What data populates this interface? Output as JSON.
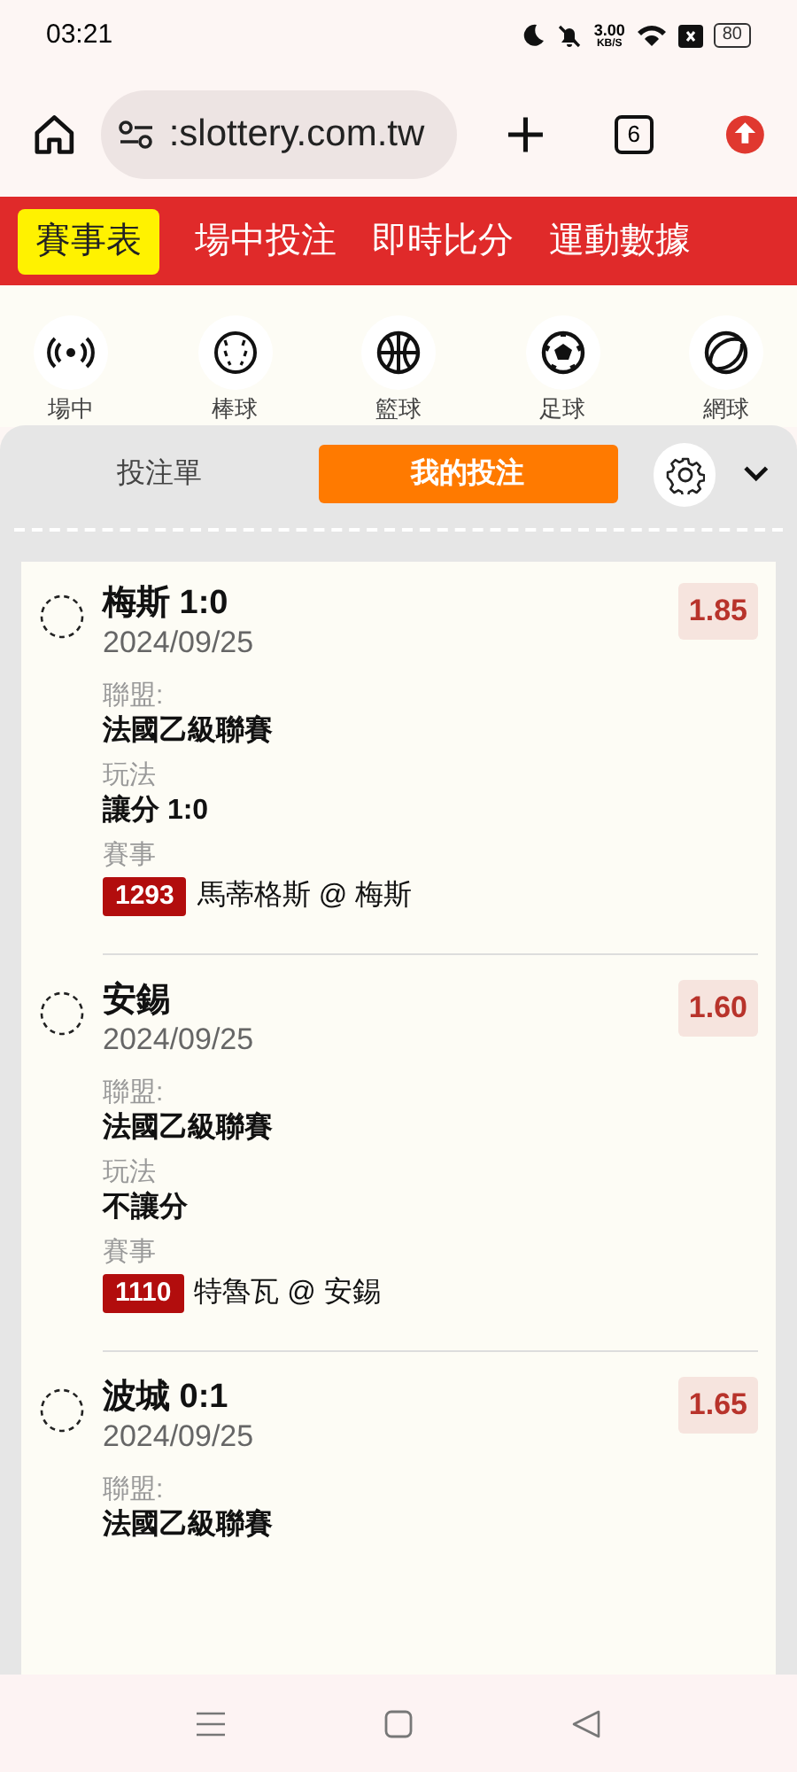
{
  "status_bar": {
    "time": "03:21",
    "speed": "3.00",
    "speed_unit": "KB/S",
    "battery": "80"
  },
  "browser": {
    "url": ":slottery.com.tw",
    "tab_count": "6"
  },
  "nav_tabs": [
    {
      "label": "賽事表",
      "selected": true
    },
    {
      "label": "場中投注",
      "selected": false
    },
    {
      "label": "即時比分",
      "selected": false
    },
    {
      "label": "運動數據",
      "selected": false
    }
  ],
  "sports": [
    {
      "kind": "live",
      "label": "場中"
    },
    {
      "kind": "baseball",
      "label": "棒球"
    },
    {
      "kind": "basketball",
      "label": "籃球"
    },
    {
      "kind": "soccer",
      "label": "足球"
    },
    {
      "kind": "tennis",
      "label": "網球"
    }
  ],
  "panel_tabs": [
    {
      "label": "投注單",
      "selected": false
    },
    {
      "label": "我的投注",
      "selected": true
    }
  ],
  "bets": [
    {
      "title": "梅斯 1:0",
      "date": "2024/09/25",
      "odds": "1.85",
      "fields": [
        {
          "kind": "text",
          "label": "聯盟:",
          "value": "法國乙級聯賽"
        },
        {
          "kind": "text",
          "label": "玩法",
          "value": "讓分 1:0"
        },
        {
          "kind": "match",
          "label": "賽事",
          "code": "1293",
          "value": "馬蒂格斯 @ 梅斯"
        }
      ]
    },
    {
      "title": "安錫",
      "date": "2024/09/25",
      "odds": "1.60",
      "fields": [
        {
          "kind": "text",
          "label": "聯盟:",
          "value": "法國乙級聯賽"
        },
        {
          "kind": "text",
          "label": "玩法",
          "value": "不讓分"
        },
        {
          "kind": "match",
          "label": "賽事",
          "code": "1110",
          "value": "特魯瓦 @ 安錫"
        }
      ]
    },
    {
      "title": "波城 0:1",
      "date": "2024/09/25",
      "odds": "1.65",
      "fields": [
        {
          "kind": "text",
          "label": "聯盟:",
          "value": "法國乙級聯賽"
        }
      ]
    }
  ]
}
